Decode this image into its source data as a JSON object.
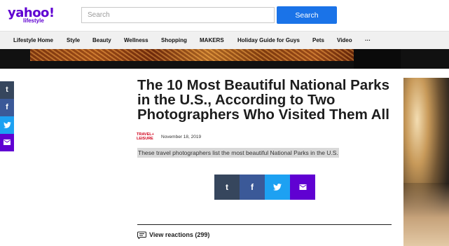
{
  "header": {
    "logo_main": "yahoo!",
    "logo_sub": "lifestyle",
    "search_placeholder": "Search",
    "search_button": "Search"
  },
  "nav": {
    "items": [
      "Lifestyle Home",
      "Style",
      "Beauty",
      "Wellness",
      "Shopping",
      "MAKERS",
      "Holiday Guide for Guys",
      "Pets",
      "Video",
      "···"
    ]
  },
  "side_share": {
    "tumblr": "t",
    "facebook": "f",
    "twitter": "twitter-icon",
    "email": "email-icon"
  },
  "article": {
    "title": "The 10 Most Beautiful National Parks in the U.S., According to Two Photographers Who Visited Them All",
    "source_line1": "TRAVEL+",
    "source_line2": "LEISURE",
    "date": "November 18, 2019",
    "summary": "These travel photographers list the most beautiful National Parks in the U.S."
  },
  "share_buttons": {
    "tumblr": "t",
    "facebook": "f",
    "twitter": "twitter-icon",
    "email": "email-icon"
  },
  "reactions": {
    "label": "View reactions (299)"
  },
  "colors": {
    "brand": "#6001d2",
    "search_button": "#1a73e8",
    "tumblr": "#36465d",
    "facebook": "#3b5998",
    "twitter": "#1da1f2",
    "email": "#6001d2"
  }
}
